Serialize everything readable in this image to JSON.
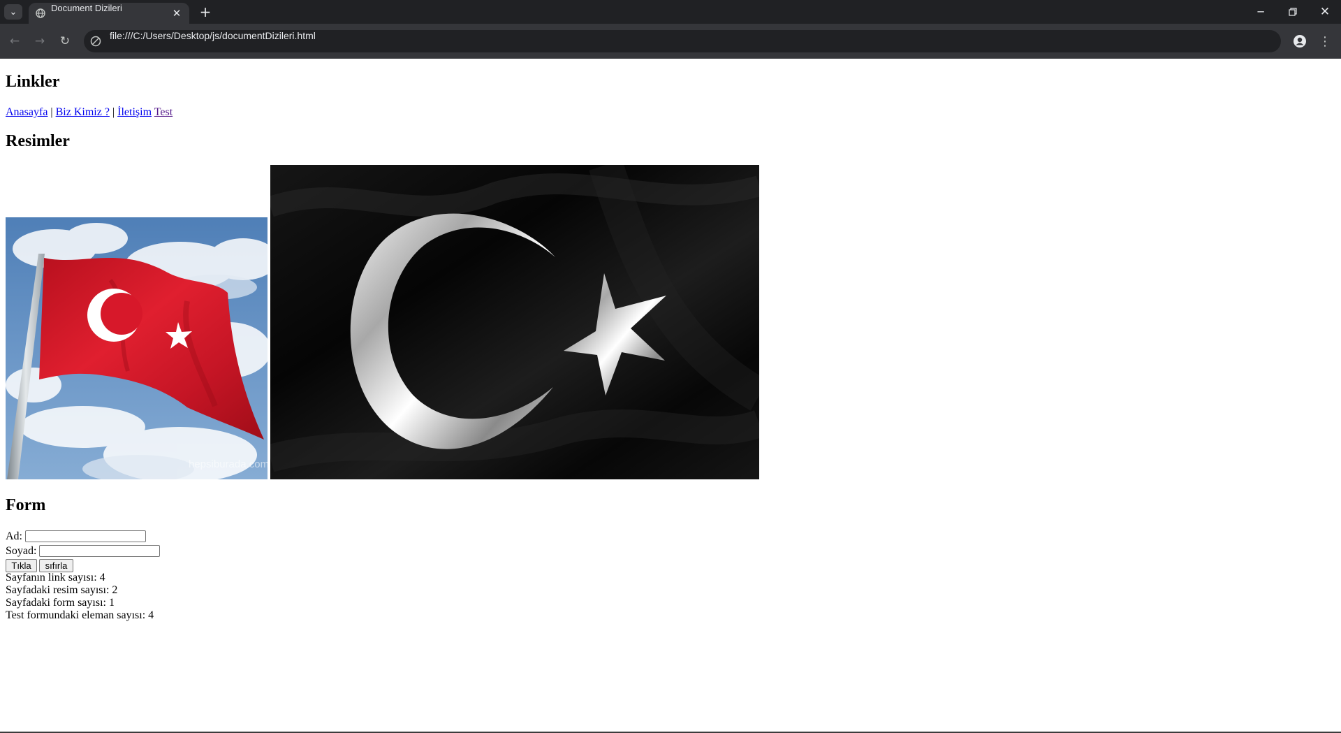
{
  "browser": {
    "tab_title": "Document Dizileri",
    "url": "file:///C:/Users/Desktop/js/documentDizileri.html"
  },
  "page": {
    "links_heading": "Linkler",
    "links": [
      {
        "label": "Anasayfa"
      },
      {
        "label": "Biz Kimiz ?"
      },
      {
        "label": "İletişim"
      },
      {
        "label": "Test"
      }
    ],
    "separator": "|",
    "images_heading": "Resimler",
    "form_heading": "Form",
    "form": {
      "ad_label": "Ad:",
      "ad_value": "",
      "soyad_label": "Soyad:",
      "soyad_value": "",
      "submit_label": "Tıkla",
      "reset_label": "sıfırla"
    },
    "stats": {
      "links": "Sayfanın link sayısı: 4",
      "images": "Sayfadaki resim sayısı: 2",
      "forms": "Sayfadaki form sayısı: 1",
      "elements": "Test formundaki eleman sayısı: 4"
    },
    "image1_watermark": "hepsiburada.com",
    "colors": {
      "link": "#0000ee",
      "visited_link": "#551a8b",
      "flag_red": "#d7182a"
    }
  }
}
